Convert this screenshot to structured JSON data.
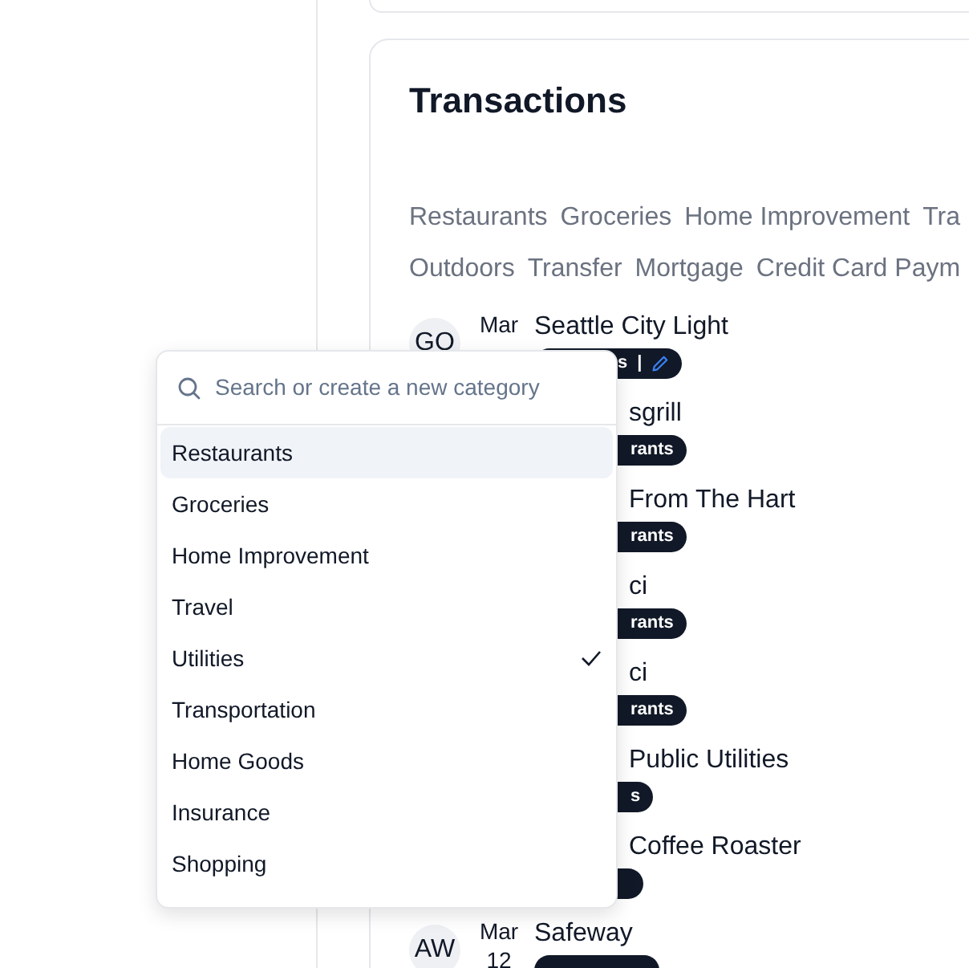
{
  "transactions": {
    "title": "Transactions",
    "filter_rows": [
      [
        "Restaurants",
        "Groceries",
        "Home Improvement",
        "Tra"
      ],
      [
        "Outdoors",
        "Transfer",
        "Mortgage",
        "Credit Card Paym"
      ]
    ],
    "rows": [
      {
        "kind": "full",
        "avatar": "GO",
        "month": "Mar",
        "name": "Seattle City Light",
        "tag": {
          "kind": "covered",
          "label": "s",
          "separator": "|",
          "editable": true
        }
      },
      {
        "kind": "covered",
        "name": "sgrill",
        "tag": {
          "kind": "covered",
          "label": "rants"
        }
      },
      {
        "kind": "covered",
        "name": "From The Hart",
        "tag": {
          "kind": "covered",
          "label": "rants"
        }
      },
      {
        "kind": "covered",
        "name": "ci",
        "tag": {
          "kind": "covered",
          "label": "rants"
        }
      },
      {
        "kind": "covered",
        "name": "ci",
        "tag": {
          "kind": "covered",
          "label": "rants"
        }
      },
      {
        "kind": "covered",
        "name": "Public Utilities",
        "tag": {
          "kind": "covered",
          "label": "s"
        }
      },
      {
        "kind": "covered",
        "name": "Coffee Roaster",
        "tag": {
          "kind": "edge"
        }
      },
      {
        "kind": "full",
        "avatar": "AW",
        "month": "Mar",
        "day": "12",
        "name": "Safeway",
        "tag": {
          "kind": "cut"
        }
      }
    ]
  },
  "category_menu": {
    "placeholder": "Search or create a new category",
    "items": [
      {
        "label": "Restaurants",
        "highlighted": true,
        "checked": false
      },
      {
        "label": "Groceries",
        "highlighted": false,
        "checked": false
      },
      {
        "label": "Home Improvement",
        "highlighted": false,
        "checked": false
      },
      {
        "label": "Travel",
        "highlighted": false,
        "checked": false
      },
      {
        "label": "Utilities",
        "highlighted": false,
        "checked": true
      },
      {
        "label": "Transportation",
        "highlighted": false,
        "checked": false
      },
      {
        "label": "Home Goods",
        "highlighted": false,
        "checked": false
      },
      {
        "label": "Insurance",
        "highlighted": false,
        "checked": false
      },
      {
        "label": "Shopping",
        "highlighted": false,
        "checked": false
      }
    ]
  }
}
